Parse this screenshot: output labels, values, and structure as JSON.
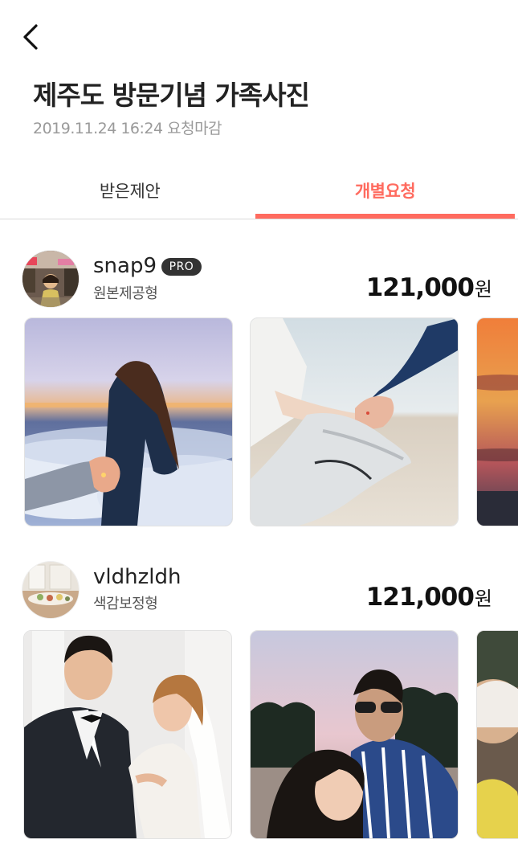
{
  "header": {
    "back_icon": "chevron-left-icon",
    "title": "제주도 방문기념 가족사진",
    "subtitle": "2019.11.24 16:24 요청마감"
  },
  "tabs": [
    {
      "label": "받은제안",
      "active": false
    },
    {
      "label": "개별요청",
      "active": true
    }
  ],
  "colors": {
    "accent": "#ff6b5f",
    "badge_bg": "#333333"
  },
  "offers": [
    {
      "name": "snap9",
      "badge": "PRO",
      "type": "원본제공형",
      "price": "121,000",
      "currency": "원",
      "photos": [
        "couple-hand-clouds-photo",
        "couple-hand-beach-photo",
        "sunset-photo"
      ]
    },
    {
      "name": "vldhzldh",
      "badge": "",
      "type": "색감보정형",
      "price": "121,000",
      "currency": "원",
      "photos": [
        "wedding-couple-photo",
        "couple-palm-trees-photo",
        "child-photo"
      ]
    }
  ]
}
